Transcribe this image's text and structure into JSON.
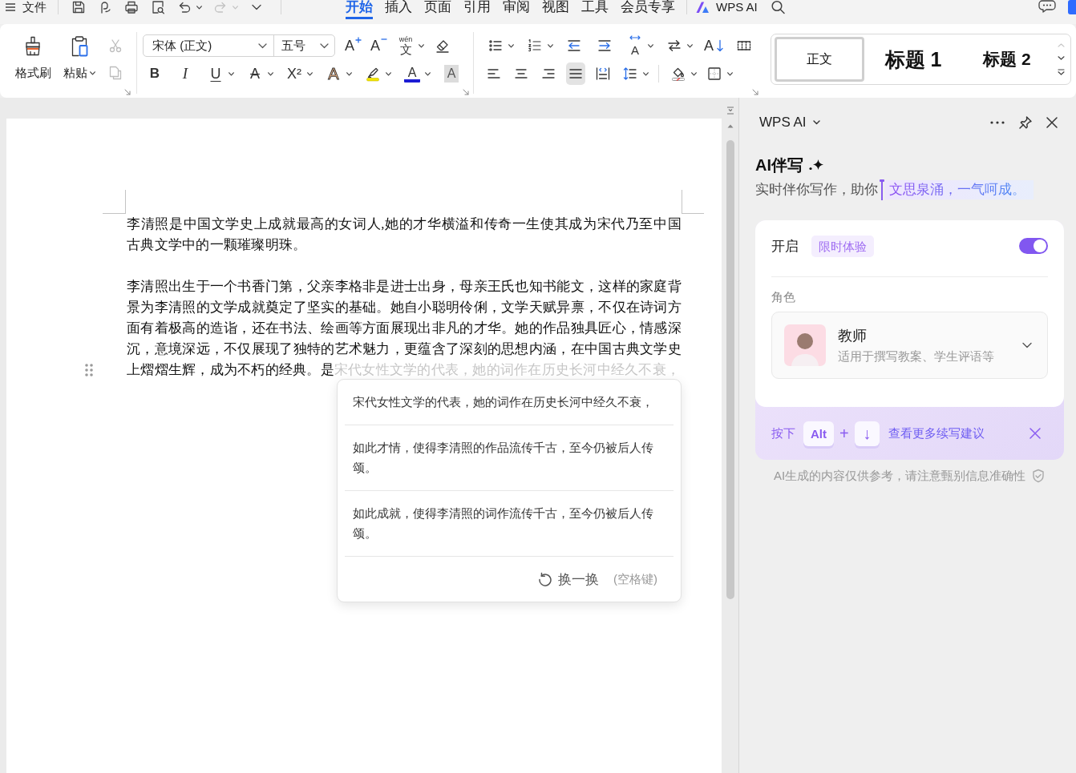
{
  "menu_bar": {
    "file_menu": "文件",
    "quick_access": [
      {
        "kind": "save",
        "disabled": false
      },
      {
        "kind": "curve",
        "disabled": false
      },
      {
        "kind": "print",
        "disabled": false
      },
      {
        "kind": "preview",
        "disabled": false
      },
      {
        "kind": "undo",
        "disabled": false
      },
      {
        "kind": "redo",
        "disabled": true
      },
      {
        "kind": "more",
        "disabled": false
      }
    ],
    "tabs": [
      {
        "label": "开始",
        "selected": true
      },
      {
        "label": "插入",
        "selected": false
      },
      {
        "label": "页面",
        "selected": false
      },
      {
        "label": "引用",
        "selected": false
      },
      {
        "label": "审阅",
        "selected": false
      },
      {
        "label": "视图",
        "selected": false
      },
      {
        "label": "工具",
        "selected": false
      },
      {
        "label": "会员专享",
        "selected": false
      }
    ],
    "ai_tab": "WPS AI"
  },
  "ribbon": {
    "clipboard": {
      "format_painter": "格式刷",
      "paste": "粘贴",
      "tools": [
        {
          "kind": "cut",
          "disabled": true
        },
        {
          "kind": "copy",
          "disabled": true
        }
      ]
    },
    "font": {
      "family": "宋体 (正文)",
      "size": "五号",
      "row_1": [
        {
          "kind": "grow",
          "glyph": "A"
        },
        {
          "kind": "shrink",
          "glyph": "A"
        },
        {
          "kind": "phonetic",
          "glyph": "文",
          "ruby": "wén"
        },
        {
          "kind": "clear"
        }
      ],
      "row_2": [
        {
          "kind": "bold",
          "glyph": "B"
        },
        {
          "kind": "italic",
          "glyph": "I"
        },
        {
          "kind": "underline",
          "glyph": "U"
        },
        {
          "kind": "strikethrough",
          "glyph": "A"
        },
        {
          "kind": "superscript",
          "glyph": "X²"
        },
        {
          "kind": "text_effect",
          "glyph": "A"
        },
        {
          "kind": "highlight"
        },
        {
          "kind": "font_color",
          "glyph": "A"
        },
        {
          "kind": "char_shading",
          "glyph": "A"
        }
      ]
    },
    "paragraph": {
      "row_1": [
        {
          "kind": "bullets"
        },
        {
          "kind": "numbering"
        },
        {
          "kind": "outdent"
        },
        {
          "kind": "indent"
        },
        {
          "kind": "text_direction",
          "glyph": "A"
        },
        {
          "kind": "swap"
        },
        {
          "kind": "sort",
          "glyph": "A"
        },
        {
          "kind": "gridlines"
        }
      ],
      "alignment": [
        {
          "kind": "left",
          "selected": false
        },
        {
          "kind": "center",
          "selected": false
        },
        {
          "kind": "right",
          "selected": false
        },
        {
          "kind": "justify",
          "selected": true
        },
        {
          "kind": "distributed",
          "selected": false
        }
      ],
      "row_2": [
        {
          "kind": "line_spacing"
        },
        {
          "kind": "shading"
        },
        {
          "kind": "borders"
        }
      ]
    },
    "styles": [
      {
        "kind": "body",
        "label": "正文",
        "selected": true
      },
      {
        "kind": "heading_1",
        "label": "标题 1",
        "selected": false
      },
      {
        "kind": "heading_2",
        "label": "标题 2",
        "selected": false
      }
    ]
  },
  "document": {
    "paragraphs": [
      {
        "text": "李清照是中国文学史上成就最高的女词人,她的才华横溢和传奇一生使其成为宋代乃至中国古典文学中的一颗璀璨明珠。"
      },
      {
        "text": "李清照出生于一个书香门第，父亲李格非是进士出身，母亲王氏也知书能文，这样的家庭背景为李清照的文学成就奠定了坚实的基础。她自小聪明伶俐，文学天赋异禀，不仅在诗词方面有着极高的造诣，还在书法、绘画等方面展现出非凡的才华。她的作品独具匠心，情感深沉，意境深远，不仅展现了独特的艺术魅力，更蕴含了深刻的思想内涵，在中国古典文学史上熠熠生辉，成为不朽的经典。是",
        "ghost_text": "宋代女性文学的代表，她的词作在历史长河中经久不衰，"
      }
    ]
  },
  "suggestion_popup": {
    "items": [
      "宋代女性文学的代表，她的词作在历史长河中经久不衰，",
      "如此才情，使得李清照的作品流传千古，至今仍被后人传颂。",
      "如此成就，使得李清照的词作流传千古，至今仍被后人传颂。"
    ],
    "refresh": "换一换",
    "shortcut": "(空格键)"
  },
  "ai_panel": {
    "title": "WPS AI",
    "heading": "AI伴写",
    "tagline": "实时伴你写作，助你",
    "tagline_highlight": "文思泉涌，一气呵成。",
    "enable_label": "开启",
    "badge": "限时体验",
    "enabled": true,
    "role_label": "角色",
    "role": {
      "name": "教师",
      "description": "适用于撰写教案、学生评语等"
    },
    "hint": {
      "prefix": "按下",
      "keys": [
        "Alt",
        "↓"
      ],
      "joiner": "+",
      "link": "查看更多续写建议"
    },
    "disclaimer": "AI生成的内容仅供参考，请注意甄别信息准确性"
  }
}
